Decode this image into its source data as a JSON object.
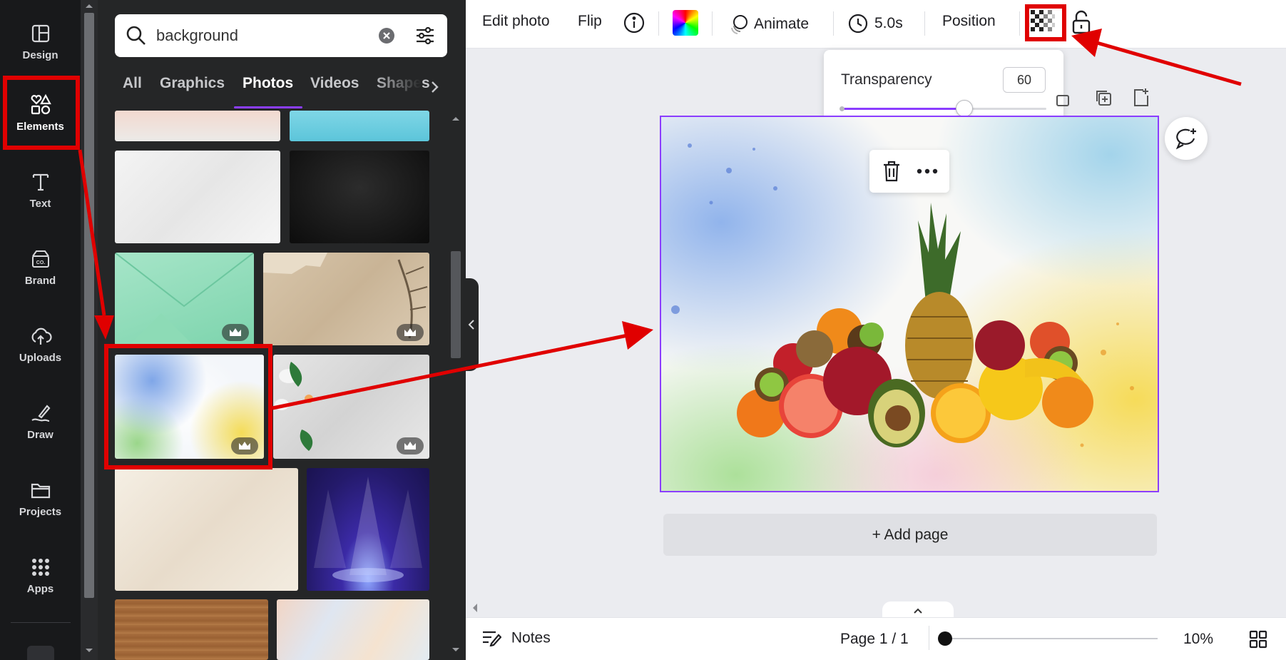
{
  "rail": {
    "items": [
      {
        "label": "Design",
        "icon": "layout-icon"
      },
      {
        "label": "Elements",
        "icon": "shapes-icon"
      },
      {
        "label": "Text",
        "icon": "text-icon"
      },
      {
        "label": "Brand",
        "icon": "brand-icon"
      },
      {
        "label": "Uploads",
        "icon": "cloud-upload-icon"
      },
      {
        "label": "Draw",
        "icon": "draw-icon"
      },
      {
        "label": "Projects",
        "icon": "folder-icon"
      },
      {
        "label": "Apps",
        "icon": "apps-grid-icon"
      }
    ]
  },
  "search": {
    "value": "background",
    "placeholder": "Search"
  },
  "tabs": [
    "All",
    "Graphics",
    "Photos",
    "Videos",
    "Shapes"
  ],
  "active_tab": "Photos",
  "toolbar": {
    "edit_photo": "Edit photo",
    "flip": "Flip",
    "animate": "Animate",
    "duration": "5.0s",
    "position": "Position"
  },
  "transparency": {
    "label": "Transparency",
    "value": "60",
    "level": 0.6
  },
  "canvas": {
    "add_page": "+ Add page"
  },
  "bottombar": {
    "notes": "Notes",
    "page": "Page 1 / 1",
    "zoom": "10%",
    "zoom_level": 0.0
  },
  "colors": {
    "accent": "#8b3dff",
    "annotation": "#e00000",
    "rail_bg": "#18191b",
    "panel_bg": "#252627"
  }
}
